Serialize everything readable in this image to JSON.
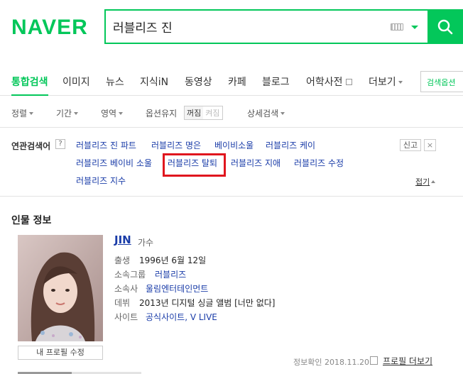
{
  "header": {
    "logo": "NAVER",
    "search_value": "러블리즈 진"
  },
  "tabs": {
    "items": [
      {
        "label": "통합검색",
        "active": true
      },
      {
        "label": "이미지"
      },
      {
        "label": "뉴스"
      },
      {
        "label": "지식iN"
      },
      {
        "label": "동영상"
      },
      {
        "label": "카페"
      },
      {
        "label": "블로그"
      },
      {
        "label": "어학사전"
      },
      {
        "label": "더보기"
      }
    ],
    "option_label": "검색옵션"
  },
  "filters": {
    "sort": "정렬",
    "period": "기간",
    "area": "영역",
    "keep_option": "옵션유지",
    "off": "꺼짐",
    "on": "켜짐",
    "detail": "상세검색"
  },
  "related": {
    "title": "연관검색어",
    "help": "?",
    "report": "신고",
    "close": "×",
    "fold": "접기",
    "keywords": [
      "러블리즈 진 파트",
      "러블리즈 명은",
      "베이비소울",
      "러블리즈 케이",
      "러블리즈 베이비 소울",
      "러블리즈 탈퇴",
      "러블리즈 지애",
      "러블리즈 수정",
      "러블리즈 지수"
    ],
    "highlight_color": "#e0161e"
  },
  "person": {
    "section_title": "인물 정보",
    "name": "JIN",
    "role": "가수",
    "edit_button": "내 프로필 수정",
    "fields": [
      {
        "label": "출생",
        "value": "1996년 6월 12일"
      },
      {
        "label": "소속그룹",
        "value": "러블리즈"
      },
      {
        "label": "소속사",
        "value": "울림엔터테인먼트"
      },
      {
        "label": "데뷔",
        "value": "2013년 디지털 싱글 앨범 [너만 없다]"
      },
      {
        "label": "사이트",
        "value": "공식사이트, V LIVE"
      }
    ],
    "verify_label": "정보확인",
    "verify_date": "2018.11.20.",
    "more_profile": "프로필 더보기"
  },
  "colors": {
    "brand": "#03c75a",
    "link": "#1a3ca8"
  }
}
